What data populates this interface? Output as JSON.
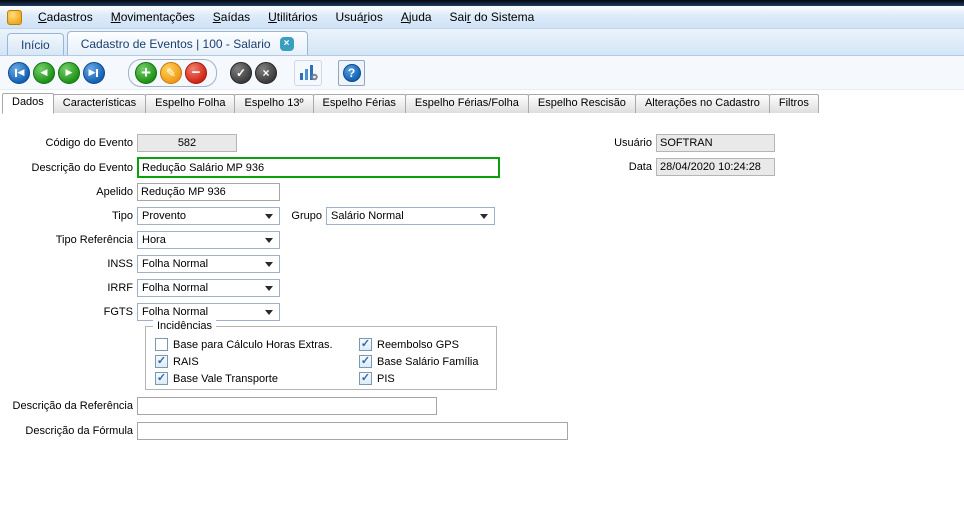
{
  "menu": {
    "items": [
      {
        "id": "cadastros",
        "pre": "",
        "key": "C",
        "post": "adastros"
      },
      {
        "id": "movimentacoes",
        "pre": "",
        "key": "M",
        "post": "ovimentações"
      },
      {
        "id": "saidas",
        "pre": "",
        "key": "S",
        "post": "aídas"
      },
      {
        "id": "utilitarios",
        "pre": "",
        "key": "U",
        "post": "tilitários"
      },
      {
        "id": "usuarios",
        "pre": "Usuá",
        "key": "r",
        "post": "ios"
      },
      {
        "id": "ajuda",
        "pre": "",
        "key": "A",
        "post": "juda"
      },
      {
        "id": "sair-do-sistema",
        "pre": "Sai",
        "key": "r",
        "post": " do Sistema"
      }
    ]
  },
  "tabs": {
    "home": "Início",
    "active": "Cadastro de Eventos | 100 - Salario",
    "close_glyph": "×"
  },
  "toolbar": {
    "nav": [
      {
        "id": "nav-first",
        "glyph": "◀",
        "style": "blue",
        "bar": "left"
      },
      {
        "id": "nav-prev",
        "glyph": "◀",
        "style": "green"
      },
      {
        "id": "nav-next",
        "glyph": "▶",
        "style": "green"
      },
      {
        "id": "nav-last",
        "glyph": "▶",
        "style": "blue",
        "bar": "right"
      }
    ],
    "crud": [
      {
        "id": "add",
        "glyph": "+",
        "style": "green big"
      },
      {
        "id": "edit",
        "glyph": "✎",
        "style": "orange"
      },
      {
        "id": "delete",
        "glyph": "−",
        "style": "red"
      }
    ],
    "confirm": [
      {
        "id": "confirm",
        "glyph": "✓",
        "style": "dark"
      },
      {
        "id": "cancel",
        "glyph": "×",
        "style": "dark"
      }
    ],
    "help_glyph": "?"
  },
  "page_tabs": {
    "active_index": 0,
    "items": [
      {
        "id": "dados",
        "label": "Dados"
      },
      {
        "id": "caracteristicas",
        "label": "Características"
      },
      {
        "id": "espelho-folha",
        "label": "Espelho Folha"
      },
      {
        "id": "espelho-13",
        "label": "Espelho 13º"
      },
      {
        "id": "espelho-ferias",
        "label": "Espelho Férias"
      },
      {
        "id": "espelho-ferias-folha",
        "label": "Espelho Férias/Folha"
      },
      {
        "id": "espelho-rescisao",
        "label": "Espelho Rescisão"
      },
      {
        "id": "alteracoes-no-cadastro",
        "label": "Alterações no Cadastro"
      },
      {
        "id": "filtros",
        "label": "Filtros"
      }
    ]
  },
  "form": {
    "codigo": {
      "label": "Código do Evento",
      "value": "582"
    },
    "usuario": {
      "label": "Usuário",
      "value": "SOFTRAN"
    },
    "descricao": {
      "label": "Descrição do Evento",
      "value": "Redução Salário MP 936"
    },
    "data": {
      "label": "Data",
      "value": "28/04/2020 10:24:28"
    },
    "apelido": {
      "label": "Apelido",
      "value": "Redução MP 936"
    },
    "tipo": {
      "label": "Tipo",
      "value": "Provento"
    },
    "grupo": {
      "label": "Grupo",
      "value": "Salário Normal"
    },
    "tipo_referencia": {
      "label": "Tipo Referência",
      "value": "Hora"
    },
    "inss": {
      "label": "INSS",
      "value": "Folha Normal"
    },
    "irrf": {
      "label": "IRRF",
      "value": "Folha Normal"
    },
    "fgts": {
      "label": "FGTS",
      "value": "Folha Normal"
    },
    "incidencias": {
      "legend": "Incidências",
      "check_glyph": "✓",
      "col1": [
        {
          "label": "Base para Cálculo Horas Extras.",
          "checked": false
        },
        {
          "label": "RAIS",
          "checked": true
        },
        {
          "label": "Base Vale Transporte",
          "checked": true
        }
      ],
      "col2": [
        {
          "label": "Reembolso GPS",
          "checked": true
        },
        {
          "label": "Base Salário Família",
          "checked": true
        },
        {
          "label": "PIS",
          "checked": true
        }
      ]
    },
    "descricao_referencia": {
      "label": "Descrição da Referência",
      "value": ""
    },
    "descricao_formula": {
      "label": "Descrição da Fórmula",
      "value": ""
    }
  }
}
